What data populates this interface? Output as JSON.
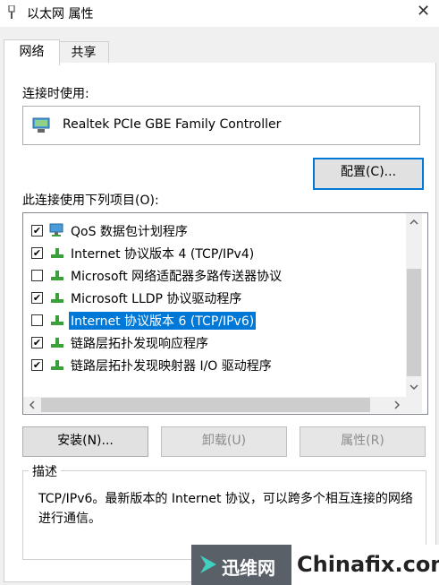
{
  "window": {
    "title": "以太网 属性"
  },
  "tabs": [
    {
      "label": "网络"
    },
    {
      "label": "共享"
    }
  ],
  "connect_using_label": "连接时使用:",
  "adapter": {
    "name": "Realtek PCIe GBE Family Controller",
    "icon": "network-adapter-icon"
  },
  "configure_button": "配置(C)...",
  "items_label": "此连接使用下列项目(O):",
  "items": [
    {
      "label": "QoS 数据包计划程序",
      "checked": true,
      "selected": false,
      "icon": "qos-network-icon"
    },
    {
      "label": "Internet 协议版本 4 (TCP/IPv4)",
      "checked": true,
      "selected": false,
      "icon": "protocol-icon"
    },
    {
      "label": "Microsoft 网络适配器多路传送器协议",
      "checked": false,
      "selected": false,
      "icon": "protocol-icon"
    },
    {
      "label": "Microsoft LLDP 协议驱动程序",
      "checked": true,
      "selected": false,
      "icon": "protocol-icon"
    },
    {
      "label": "Internet 协议版本 6 (TCP/IPv6)",
      "checked": false,
      "selected": true,
      "icon": "protocol-icon"
    },
    {
      "label": "链路层拓扑发现响应程序",
      "checked": true,
      "selected": false,
      "icon": "protocol-icon"
    },
    {
      "label": "链路层拓扑发现映射器 I/O 驱动程序",
      "checked": true,
      "selected": false,
      "icon": "protocol-icon"
    }
  ],
  "buttons": {
    "install": "安装(N)...",
    "uninstall": "卸载(U)",
    "properties": "属性(R)"
  },
  "description": {
    "label": "描述",
    "text": "TCP/IPv6。最新版本的 Internet 协议，可以跨多个相互连接的网络进行通信。"
  },
  "watermark": {
    "cn": "迅维网",
    "en": "Chinafix.com"
  },
  "colors": {
    "selection": "#0078d7",
    "protocol_icon": "#3aa13a"
  }
}
